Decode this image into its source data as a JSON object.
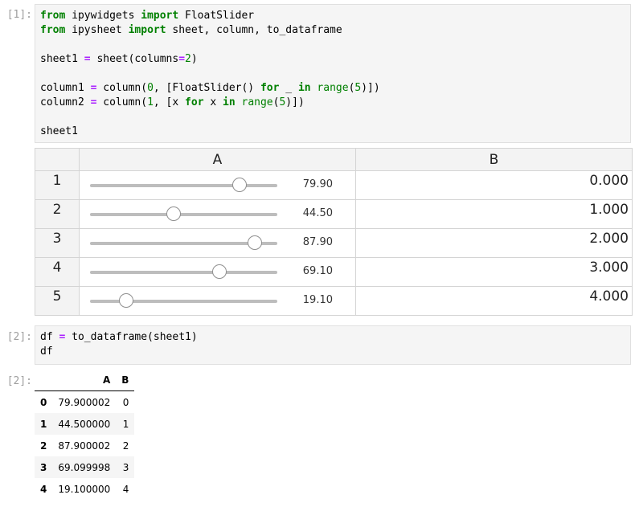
{
  "cell1": {
    "prompt": "[1]:",
    "lines": [
      [
        {
          "t": "from",
          "c": "kw"
        },
        {
          "t": " ipywidgets "
        },
        {
          "t": "import",
          "c": "kw"
        },
        {
          "t": " FloatSlider"
        }
      ],
      [
        {
          "t": "from",
          "c": "kw"
        },
        {
          "t": " ipysheet "
        },
        {
          "t": "import",
          "c": "kw"
        },
        {
          "t": " sheet, column, to_dataframe"
        }
      ],
      [],
      [
        {
          "t": "sheet1 "
        },
        {
          "t": "=",
          "c": "op"
        },
        {
          "t": " sheet(columns"
        },
        {
          "t": "=",
          "c": "op"
        },
        {
          "t": "2",
          "c": "num"
        },
        {
          "t": ")"
        }
      ],
      [],
      [
        {
          "t": "column1 "
        },
        {
          "t": "=",
          "c": "op"
        },
        {
          "t": " column("
        },
        {
          "t": "0",
          "c": "num"
        },
        {
          "t": ", [FloatSlider() "
        },
        {
          "t": "for",
          "c": "kw"
        },
        {
          "t": " _ "
        },
        {
          "t": "in",
          "c": "kw"
        },
        {
          "t": " "
        },
        {
          "t": "range",
          "c": "bi"
        },
        {
          "t": "("
        },
        {
          "t": "5",
          "c": "num"
        },
        {
          "t": ")])"
        }
      ],
      [
        {
          "t": "column2 "
        },
        {
          "t": "=",
          "c": "op"
        },
        {
          "t": " column("
        },
        {
          "t": "1",
          "c": "num"
        },
        {
          "t": ", [x "
        },
        {
          "t": "for",
          "c": "kw"
        },
        {
          "t": " x "
        },
        {
          "t": "in",
          "c": "kw"
        },
        {
          "t": " "
        },
        {
          "t": "range",
          "c": "bi"
        },
        {
          "t": "("
        },
        {
          "t": "5",
          "c": "num"
        },
        {
          "t": ")])"
        }
      ],
      [],
      [
        {
          "t": "sheet1"
        }
      ]
    ]
  },
  "sheet": {
    "columns": [
      "A",
      "B"
    ],
    "slider_range": [
      0,
      100
    ],
    "rows": [
      {
        "label": "1",
        "slider_value": 79.9,
        "slider_text": "79.90",
        "b": "0.000"
      },
      {
        "label": "2",
        "slider_value": 44.5,
        "slider_text": "44.50",
        "b": "1.000"
      },
      {
        "label": "3",
        "slider_value": 87.9,
        "slider_text": "87.90",
        "b": "2.000"
      },
      {
        "label": "4",
        "slider_value": 69.1,
        "slider_text": "69.10",
        "b": "3.000"
      },
      {
        "label": "5",
        "slider_value": 19.1,
        "slider_text": "19.10",
        "b": "4.000"
      }
    ]
  },
  "cell2": {
    "prompt": "[2]:",
    "lines": [
      [
        {
          "t": "df "
        },
        {
          "t": "=",
          "c": "op"
        },
        {
          "t": " to_dataframe(sheet1)"
        }
      ],
      [
        {
          "t": "df"
        }
      ]
    ]
  },
  "output2": {
    "prompt": "[2]:",
    "columns": [
      "",
      "A",
      "B"
    ],
    "rows": [
      {
        "index": "0",
        "a": "79.900002",
        "b": "0"
      },
      {
        "index": "1",
        "a": "44.500000",
        "b": "1"
      },
      {
        "index": "2",
        "a": "87.900002",
        "b": "2"
      },
      {
        "index": "3",
        "a": "69.099998",
        "b": "3"
      },
      {
        "index": "4",
        "a": "19.100000",
        "b": "4"
      }
    ]
  }
}
